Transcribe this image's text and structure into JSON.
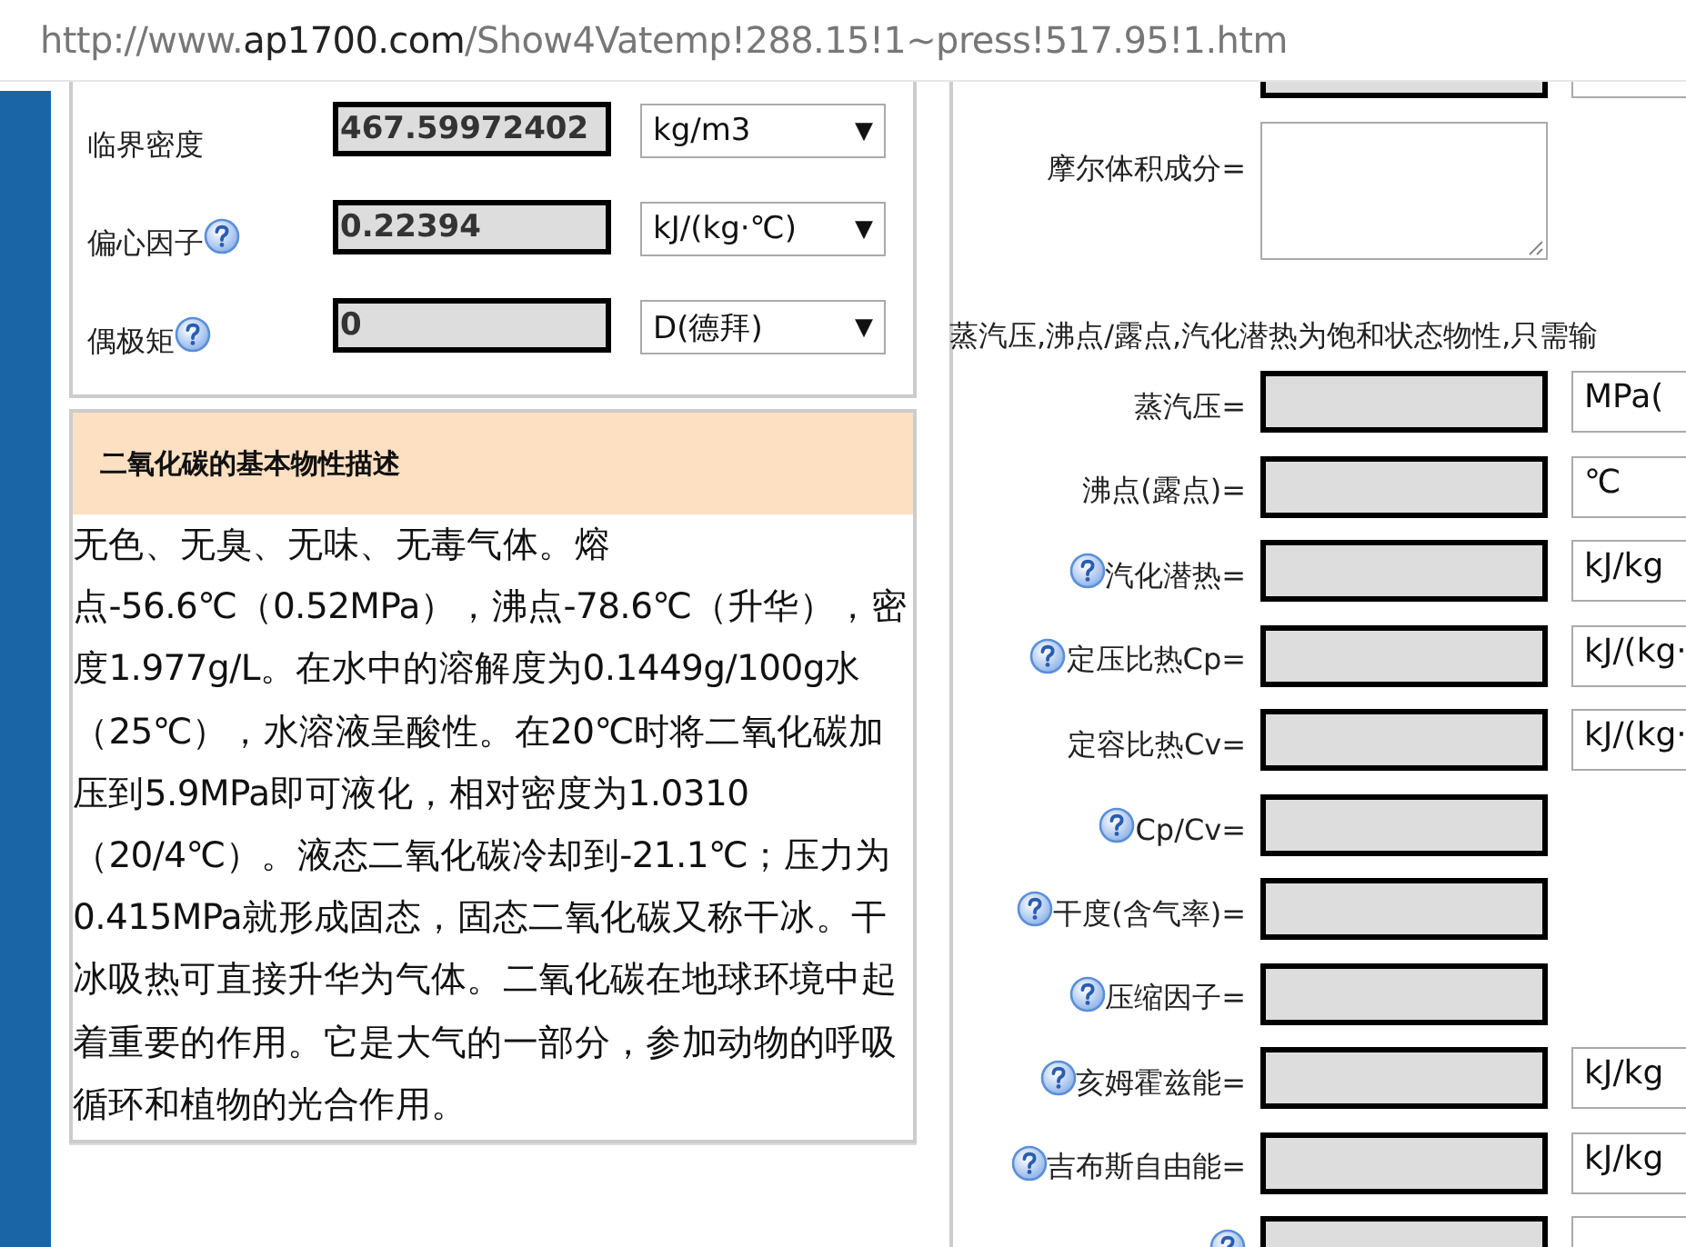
{
  "address_bar": {
    "scheme": "http://www.",
    "host": "ap1700.com",
    "path": "/Show4Vatemp!288.15!1~press!517.95!1.htm"
  },
  "left_properties": [
    {
      "label": "临界密度",
      "help": false,
      "value": "467.59972402",
      "unit": "kg/m3",
      "caret": "▼"
    },
    {
      "label": "偏心因子",
      "help": true,
      "value": "0.22394",
      "unit": "kJ/(kg·℃)",
      "caret": "▼"
    },
    {
      "label": "偶极矩",
      "help": true,
      "value": "0",
      "unit": "D(德拜)",
      "caret": "▼"
    }
  ],
  "description": {
    "title": "二氧化碳的基本物性描述",
    "text": "无色、无臭、无味、无毒气体。熔点-56.6℃（0.52MPa），沸点-78.6℃（升华），密度1.977g/L。在水中的溶解度为0.1449g/100g水（25℃），水溶液呈酸性。在20℃时将二氧化碳加压到5.9MPa即可液化，相对密度为1.0310（20/4℃）。液态二氧化碳冷却到-21.1℃；压力为0.415MPa就形成固态，固态二氧化碳又称干冰。干冰吸热可直接升华为气体。二氧化碳在地球环境中起着重要的作用。它是大气的一部分，参加动物的呼吸循环和植物的光合作用。"
  },
  "top_row": {
    "select": true
  },
  "composition": {
    "label": "摩尔体积成分="
  },
  "notice": "蒸汽压,沸点/露点,汽化潜热为饱和状态物性,只需输",
  "results": [
    {
      "label": "蒸汽压=",
      "help": false,
      "select": true,
      "unit": "MPa("
    },
    {
      "label": "沸点(露点)=",
      "help": false,
      "select": true,
      "unit": "℃"
    },
    {
      "label": "汽化潜热=",
      "help": true,
      "select": true,
      "unit": "kJ/kg"
    },
    {
      "label": "定压比热Cp=",
      "help": true,
      "select": true,
      "unit": "kJ/(kg·"
    },
    {
      "label": "定容比热Cv=",
      "help": false,
      "select": true,
      "unit": "kJ/(kg·"
    },
    {
      "label": "Cp/Cv=",
      "help": true,
      "select": false
    },
    {
      "label": "干度(含气率)=",
      "help": true,
      "select": false
    },
    {
      "label": "压缩因子=",
      "help": true,
      "select": false
    },
    {
      "label": "亥姆霍兹能=",
      "help": true,
      "select": true,
      "unit": "kJ/kg"
    },
    {
      "label": "吉布斯自由能=",
      "help": true,
      "select": true,
      "unit": "kJ/kg"
    },
    {
      "help": true,
      "select": true
    }
  ]
}
